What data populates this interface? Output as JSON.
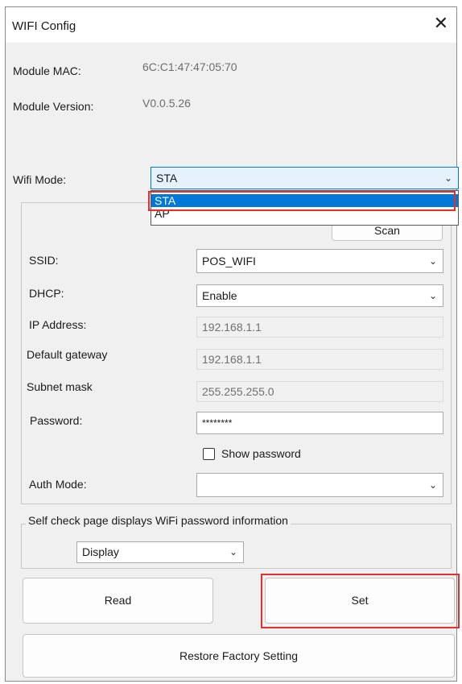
{
  "window": {
    "title": "WIFI Config",
    "close_glyph": "✕"
  },
  "module": {
    "mac_label": "Module MAC:",
    "mac_value": "6C:C1:47:47:05:70",
    "version_label": "Module Version:",
    "version_value": "V0.0.5.26"
  },
  "wifi_mode": {
    "label": "Wifi Mode:",
    "value": "STA",
    "options": [
      "STA",
      "AP"
    ],
    "selected_option": "STA"
  },
  "network": {
    "scan_label": "Scan",
    "ssid_label": "SSID:",
    "ssid_value": "POS_WIFI",
    "dhcp_label": "DHCP:",
    "dhcp_value": "Enable",
    "ip_label": "IP Address:",
    "ip_value": "192.168.1.1",
    "gateway_label": "Default gateway",
    "gateway_value": "192.168.1.1",
    "subnet_label": "Subnet mask",
    "subnet_value": "255.255.255.0",
    "password_label": "Password:",
    "password_value": "********",
    "show_password_label": "Show password",
    "auth_label": "Auth Mode:",
    "auth_value": ""
  },
  "self_check": {
    "group_label": "Self check page displays WiFi password information",
    "value": "Display"
  },
  "buttons": {
    "read": "Read",
    "set": "Set",
    "restore": "Restore Factory Setting"
  },
  "colors": {
    "highlight_red": "#e03030",
    "selection_blue": "#0078d7"
  },
  "icons": {
    "combo_arrow": "chevron-down-icon",
    "close": "close-icon"
  }
}
